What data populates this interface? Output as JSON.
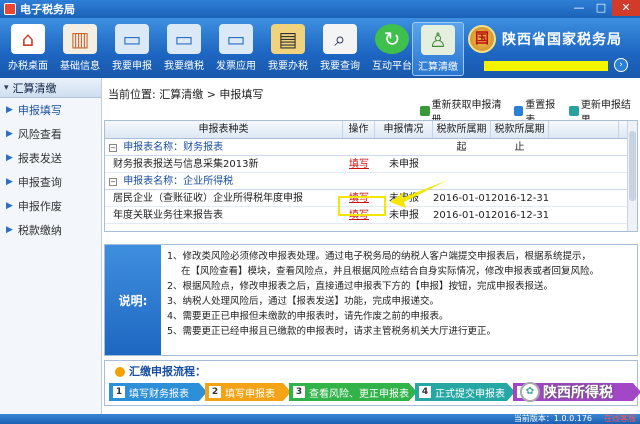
{
  "window": {
    "title": "电子税务局"
  },
  "toolbar": {
    "items": [
      {
        "label": "办税桌面",
        "icon": "home-icon",
        "color": "#d83a2a"
      },
      {
        "label": "基础信息",
        "icon": "chart-icon",
        "color": "#e7e2d0"
      },
      {
        "label": "我要申报",
        "icon": "monitor-icon",
        "color": "#cfe4f7"
      },
      {
        "label": "我要缴税",
        "icon": "monitor-icon",
        "color": "#cfe4f7"
      },
      {
        "label": "发票应用",
        "icon": "monitor-icon",
        "color": "#cfe4f7"
      },
      {
        "label": "我要办税",
        "icon": "books-icon",
        "color": "#e9c76c"
      },
      {
        "label": "我要查询",
        "icon": "search-doc-icon",
        "color": "#f0f0f0"
      },
      {
        "label": "互动平台",
        "icon": "refresh-icon",
        "color": "#3fbf4c"
      },
      {
        "label": "汇算清缴",
        "icon": "person-icon",
        "color": "#7fb86a"
      }
    ],
    "brand_name": "陕西省国家税务局",
    "emblem_glyph": "国"
  },
  "sidebar": {
    "header": "汇算清缴",
    "items": [
      {
        "label": "申报填写",
        "active": true
      },
      {
        "label": "风险查看",
        "active": false
      },
      {
        "label": "报表发送",
        "active": false
      },
      {
        "label": "申报查询",
        "active": false
      },
      {
        "label": "申报作废",
        "active": false
      },
      {
        "label": "税款缴纳",
        "active": false
      }
    ]
  },
  "breadcrumb": "当前位置:  汇算清缴  >  申报填写",
  "actions": {
    "refetch": "重新获取申报清册",
    "reset": "重置报表",
    "update": "更新申报结果"
  },
  "table": {
    "headers": [
      "申报表种类",
      "操作",
      "申报情况",
      "税款所属期起",
      "税款所属期止"
    ],
    "groups": [
      {
        "title": "申报表名称：财务报表",
        "rows": [
          {
            "name": "财务报表报送与信息采集2013新",
            "op": "填写",
            "status": "未申报",
            "start": "",
            "end": ""
          }
        ]
      },
      {
        "title": "申报表名称：企业所得税",
        "rows": [
          {
            "name": "居民企业（查账征收）企业所得税年度申报",
            "op": "填写",
            "status": "未申报",
            "start": "2016-01-01",
            "end": "2016-12-31"
          },
          {
            "name": "年度关联业务往来报告表",
            "op": "填写",
            "status": "未申报",
            "start": "2016-01-01",
            "end": "2016-12-31"
          }
        ]
      }
    ],
    "collapse_glyph": "−"
  },
  "info": {
    "label": "说明:",
    "lines": [
      "1、修改类风险必须修改申报表处理。通过电子税务局的纳税人客户端提交申报表后，根据系统提示，",
      "在【风险查看】模块，查看风险点，并且根据风险点结合自身实际情况，修改申报表或者回复风险。",
      "2、根据风险点，修改申报表之后，直接通过申报表下方的【申报】按钮，完成申报表报送。",
      "3、纳税人处理风险后，通过【报表发送】功能，完成申报递交。",
      "4、需要更正已申报但未缴款的申报表时，请先作废之前的申报表。",
      "5、需要更正已经申报且已缴款的申报表时，请求主管税务机关大厅进行更正。"
    ]
  },
  "flow": {
    "title": "汇缴申报流程：",
    "steps": [
      {
        "num": "1",
        "label": "填写财务报表"
      },
      {
        "num": "2",
        "label": "填写申报表"
      },
      {
        "num": "3",
        "label": "查看风险、更正申报表"
      },
      {
        "num": "4",
        "label": "正式提交申报表"
      },
      {
        "num": "5",
        "label": ""
      }
    ]
  },
  "watermark": "陕西所得税",
  "status": {
    "version": "当前版本：1.0.0.176",
    "extra": "在线客服"
  }
}
